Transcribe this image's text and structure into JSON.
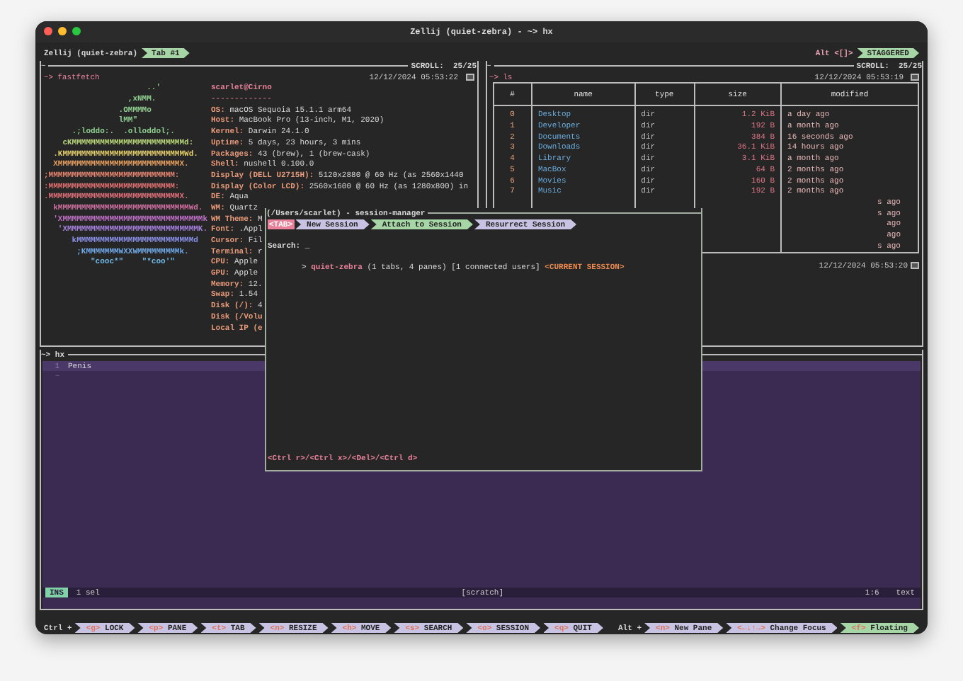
{
  "window": {
    "title": "Zellij (quiet-zebra) - ~> hx"
  },
  "tab_bar": {
    "session": "Zellij (quiet-zebra)",
    "tabs": [
      {
        "label": "Tab #1",
        "selected": true
      }
    ],
    "swap_key": "Alt <[]>",
    "layout": "STAGGERED"
  },
  "fastfetch_pane": {
    "title": "~",
    "scroll": "SCROLL:  25/25",
    "prompt": "~>",
    "command": "fastfetch",
    "timestamp": "12/12/2024 05:53:22",
    "logo": [
      "                      ..'",
      "                  ,xNMM.",
      "                .OMMMMo",
      "                lMM\"",
      "      .;loddo:.  .olloddol;.",
      "    cKMMMMMMMMMMMMMMMMMMMMMMMMd:",
      "  .KMMMMMMMMMMMMMMMMMMMMMMMMMMWd.",
      "  XMMMMMMMMMMMMMMMMMMMMMMMMMMX.",
      ";MMMMMMMMMMMMMMMMMMMMMMMMMMM:",
      ":MMMMMMMMMMMMMMMMMMMMMMMMMMM:",
      ".MMMMMMMMMMMMMMMMMMMMMMMMMMMMX.",
      "  kMMMMMMMMMMMMMMMMMMMMMMMMMMMMWd.",
      "  'XMMMMMMMMMMMMMMMMMMMMMMMMMMMMMMk",
      "   'XMMMMMMMMMMMMMMMMMMMMMMMMMMMMK.",
      "      kMMMMMMMMMMMMMMMMMMMMMMMMMd",
      "       ;KMMMMMMMWXXWMMMMMMMMMk.",
      "          \"cooc*\"    \"*coo'\""
    ],
    "info": [
      {
        "kind": "title",
        "key": "scarlet@Cirno"
      },
      {
        "kind": "rule",
        "key": "-------------"
      },
      {
        "kind": "field",
        "key": "OS:",
        "value": "macOS Sequoia 15.1.1 arm64"
      },
      {
        "kind": "field",
        "key": "Host:",
        "value": "MacBook Pro (13-inch, M1, 2020)"
      },
      {
        "kind": "field",
        "key": "Kernel:",
        "value": "Darwin 24.1.0"
      },
      {
        "kind": "field",
        "key": "Uptime:",
        "value": "5 days, 23 hours, 3 mins"
      },
      {
        "kind": "field",
        "key": "Packages:",
        "value": "43 (brew), 1 (brew-cask)"
      },
      {
        "kind": "field",
        "key": "Shell:",
        "value": "nushell 0.100.0"
      },
      {
        "kind": "field",
        "key": "Display (DELL U2715H):",
        "value": "5120x2880 @ 60 Hz (as 2560x1440"
      },
      {
        "kind": "field",
        "key": "Display (Color LCD):",
        "value": "2560x1600 @ 60 Hz (as 1280x800) in"
      },
      {
        "kind": "field",
        "key": "DE:",
        "value": "Aqua"
      },
      {
        "kind": "field",
        "key": "WM:",
        "value": "Quartz"
      },
      {
        "kind": "field",
        "key": "WM Theme:",
        "value": "M"
      },
      {
        "kind": "field",
        "key": "Font:",
        "value": ".Appl"
      },
      {
        "kind": "field",
        "key": "Cursor:",
        "value": "Fil"
      },
      {
        "kind": "field",
        "key": "Terminal:",
        "value": "r"
      },
      {
        "kind": "field",
        "key": "CPU:",
        "value": "Apple"
      },
      {
        "kind": "field",
        "key": "GPU:",
        "value": "Apple"
      },
      {
        "kind": "field",
        "key": "Memory:",
        "value": "12."
      },
      {
        "kind": "field",
        "key": "Swap:",
        "value": "1.54"
      },
      {
        "kind": "field",
        "key": "Disk (/):",
        "value": "4"
      },
      {
        "kind": "field",
        "key": "Disk (/Volu"
      },
      {
        "kind": "field",
        "key": "Local IP (e"
      }
    ]
  },
  "ls_pane": {
    "title": "~",
    "scroll": "SCROLL:  25/25",
    "prompt": "~>",
    "command": "ls",
    "timestamp": "12/12/2024 05:53:19",
    "columns": [
      "#",
      "name",
      "type",
      "size",
      "modified"
    ],
    "rows": [
      {
        "index": "0",
        "name": "Desktop",
        "type": "dir",
        "size": "1.2 KiB",
        "modified": "a day ago"
      },
      {
        "index": "1",
        "name": "Developer",
        "type": "dir",
        "size": "192 B",
        "modified": "a month ago"
      },
      {
        "index": "2",
        "name": "Documents",
        "type": "dir",
        "size": "384 B",
        "modified": "16 seconds ago"
      },
      {
        "index": "3",
        "name": "Downloads",
        "type": "dir",
        "size": "36.1 KiB",
        "modified": "14 hours ago"
      },
      {
        "index": "4",
        "name": "Library",
        "type": "dir",
        "size": "3.1 KiB",
        "modified": "a month ago"
      },
      {
        "index": "5",
        "name": "MacBox",
        "type": "dir",
        "size": "64 B",
        "modified": "2 months ago"
      },
      {
        "index": "6",
        "name": "Movies",
        "type": "dir",
        "size": "160 B",
        "modified": "2 months ago"
      },
      {
        "index": "7",
        "name": "Music",
        "type": "dir",
        "size": "192 B",
        "modified": "2 months ago"
      },
      {
        "modified": "s ago"
      },
      {
        "modified": "s ago"
      },
      {
        "modified": "ago"
      },
      {
        "modified": "ago"
      },
      {
        "modified": "s ago"
      }
    ],
    "end_timestamp": "12/12/2024 05:53:20"
  },
  "editor_pane": {
    "title": "~> hx",
    "lines": [
      {
        "number": "1",
        "text": "Penis",
        "current": true
      }
    ],
    "empty_marker": "~",
    "mode": "INS",
    "selection": "1 sel",
    "buffer": "[scratch]",
    "position": "1:6",
    "filetype": "text"
  },
  "session_manager": {
    "title": "(/Users/scarlet) - session-manager",
    "tab_key": "<TAB>",
    "tabs": [
      {
        "label": "New Session",
        "selected": false
      },
      {
        "label": "Attach to Session",
        "selected": true
      },
      {
        "label": "Resurrect Session",
        "selected": false
      }
    ],
    "search_label": "Search:",
    "cursor": "_",
    "sessions": [
      {
        "marker": ">",
        "name": "quiet-zebra",
        "details": "(1 tabs, 4 panes) [1 connected users]",
        "flag": "<CURRENT SESSION>"
      }
    ],
    "hints": "<Ctrl r>/<Ctrl x>/<Del>/<Ctrl d>"
  },
  "status_bar": {
    "ctrl_label": "Ctrl +",
    "ctrl_keys": [
      {
        "key": "<g>",
        "label": "LOCK"
      },
      {
        "key": "<p>",
        "label": "PANE"
      },
      {
        "key": "<t>",
        "label": "TAB"
      },
      {
        "key": "<n>",
        "label": "RESIZE"
      },
      {
        "key": "<h>",
        "label": "MOVE"
      },
      {
        "key": "<s>",
        "label": "SEARCH"
      },
      {
        "key": "<o>",
        "label": "SESSION"
      },
      {
        "key": "<q>",
        "label": "QUIT"
      }
    ],
    "alt_label": "Alt +",
    "alt_keys": [
      {
        "key": "<n>",
        "label": "New Pane",
        "selected": false
      },
      {
        "key": "<←↓↑→>",
        "label": "Change Focus",
        "selected": false
      },
      {
        "key": "<f>",
        "label": "Floating",
        "selected": true
      }
    ]
  }
}
